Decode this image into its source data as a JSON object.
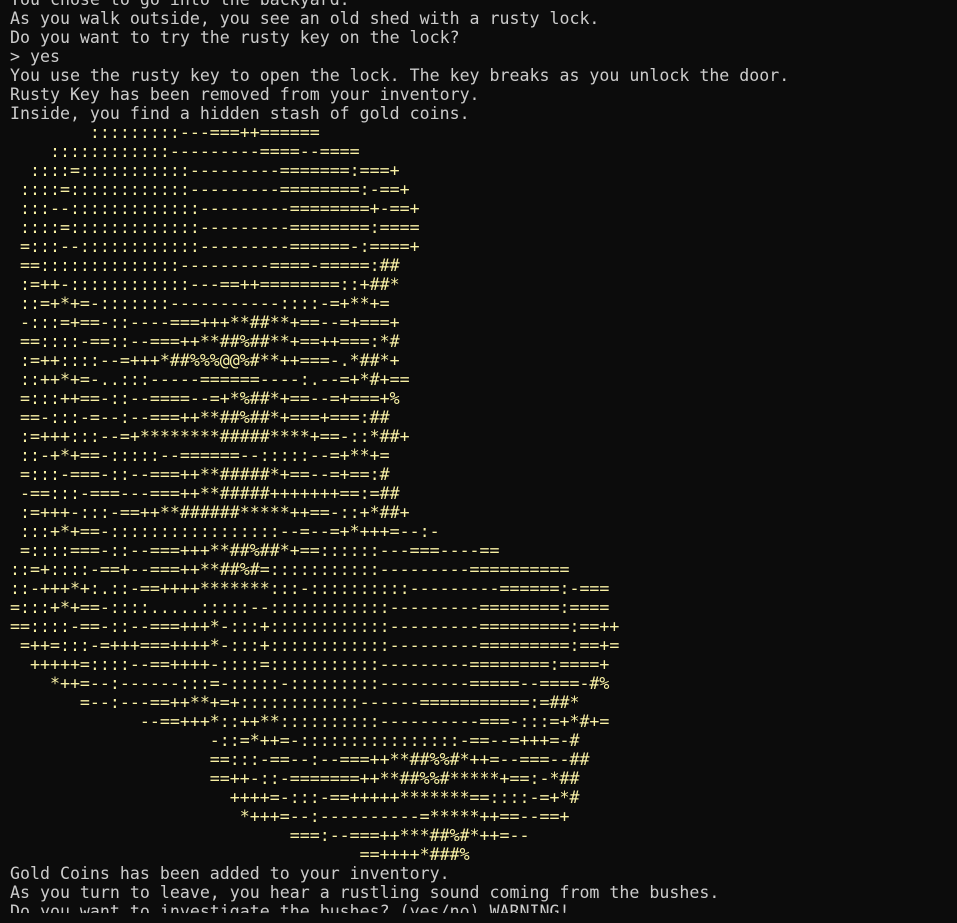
{
  "terminal": {
    "intro_lines": [
      "You chose to go into the backyard.",
      "As you walk outside, you see an old shed with a rusty lock.",
      "Do you want to try the rusty key on the lock?",
      "> yes",
      "You use the rusty key to open the lock. The key breaks as you unlock the door.",
      "Rusty Key has been removed from your inventory.",
      "Inside, you find a hidden stash of gold coins."
    ],
    "ascii_art": [
      "        :::::::::---===++======",
      "    ::::::::::::---------====--====",
      "  ::::=:::::::::::---------=======:===+",
      " ::::=::::::::::::---------========:-==+",
      " :::--:::::::::::::---------========+-==+",
      " ::::=:::::::::::::---------========:====",
      " =:::--::::::::::::---------======-:====+",
      " ==::::::::::::::---------====-=====:##",
      " :=++-::::::::::::---==++========::+##*",
      " ::=+*+=-:::::::-----------::::-=+**+=",
      " -:::=+==-::----===+++**##**+==--=+===+",
      " ==::::-==::--===++**##%##**+==++===:*#",
      " :=++::::--=+++*##%%%@@%#**++===-.*##*+",
      " ::++*+=-..:::-----======----:.--=+*#+==",
      " =:::++==-::--====--=+*%##*+==--=+===+%",
      " ==-:::-=--:--===++**##%##*+===+===:##",
      " :=+++:::--=+********#####****+==-::*##+",
      " ::-+*+==-:::::--======--:::::--=+**+=",
      " =:::-===-::--===++**#####*+==--=+==:#",
      " -==:::-===---===++**#####+++++++==:=##",
      " :=+++-:::-==++**######*****++==-::+*##+",
      " :::+*+==-:::::::::::::::::--=--=+*+++=--:-",
      " =::::===-::--===+++**##%##*+==::::::---===----==",
      "::=+::::-==+--===++**##%#=:::::::::::---------==========",
      "::-+++*+:.::-==++++*******:::-::::::::::---------======:-===",
      "=:::+*+==-::::.....:::::--::::::::::::---------========:====",
      "==::::-==-::--===+++*-:::+::::::::::::---------=========:==++",
      " =++=:::-=+++===++++*-:::+::::::::::::---------=========:==+=",
      "  +++++=::::--==++++-::::=:::::::::::---------========:====+",
      "    *++=--:------:::=-:::::-:::::::::---------=====--====-#%",
      "       =--:---==++**+=+::::::::::::------===========:=##*",
      "             --==+++*::++**::::::::::----------===-:::=+*#+=",
      "                    -::=*++=-::::::::::::::::-==--=+++=-#",
      "                    ==:::-==--:--===++**##%%#*++=--===--##",
      "                    ==++-::-=======++**##%%#*****+==:-*##",
      "                      ++++=-:::-==+++++*******==::::-=+*#",
      "                       *+++=--:----------=*****++==--==+",
      "                            ===:--===++***##%#*++=--",
      "                                   ==++++*###%"
    ],
    "outro_lines": [
      "Gold Coins has been added to your inventory.",
      "As you turn to leave, you hear a rustling sound coming from the bushes.",
      "Do you want to investigate the bushes? (yes/no) WARNING!"
    ],
    "colors": {
      "background": "#0c0c0c",
      "text": "#cccccc",
      "art": "#f9f1a5"
    }
  }
}
